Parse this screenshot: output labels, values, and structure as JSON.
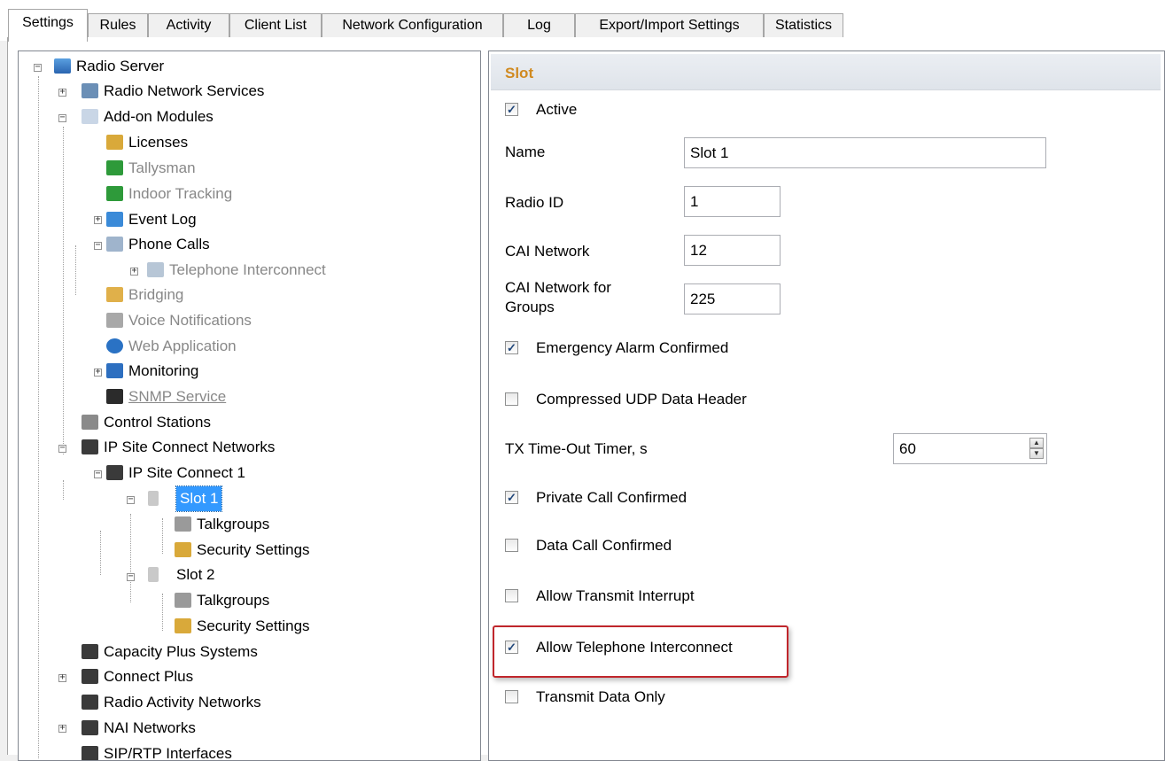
{
  "tabs": [
    "Settings",
    "Rules",
    "Activity",
    "Client List",
    "Network Configuration",
    "Log",
    "Export/Import Settings",
    "Statistics"
  ],
  "active_tab": "Settings",
  "tree": {
    "radio_server": "Radio Server",
    "radio_network_services": "Radio Network Services",
    "addon_modules": "Add-on Modules",
    "licenses": "Licenses",
    "tallysman": "Tallysman",
    "indoor_tracking": "Indoor Tracking",
    "event_log": "Event Log",
    "phone_calls": "Phone Calls",
    "telephone_interconnect": "Telephone Interconnect",
    "bridging": "Bridging",
    "voice_notifications": "Voice Notifications",
    "web_application": "Web Application",
    "monitoring": "Monitoring",
    "snmp_service": "SNMP Service",
    "control_stations": "Control Stations",
    "ip_site_connect_networks": "IP Site Connect Networks",
    "ip_site_connect_1": "IP Site Connect 1",
    "slot1": "Slot 1",
    "slot1_talkgroups": "Talkgroups",
    "slot1_security": "Security Settings",
    "slot2": "Slot 2",
    "slot2_talkgroups": "Talkgroups",
    "slot2_security": "Security Settings",
    "capacity_plus": "Capacity Plus Systems",
    "connect_plus": "Connect Plus",
    "radio_activity_networks": "Radio Activity Networks",
    "nai_networks": "NAI Networks",
    "sip_rtp": "SIP/RTP Interfaces"
  },
  "slot": {
    "title": "Slot",
    "active": {
      "label": "Active",
      "checked": true
    },
    "name": {
      "label": "Name",
      "value": "Slot 1"
    },
    "radio_id": {
      "label": "Radio ID",
      "value": "1"
    },
    "cai_network": {
      "label": "CAI Network",
      "value": "12"
    },
    "cai_groups": {
      "label_line1": "CAI Network for",
      "label_line2": "Groups",
      "value": "225"
    },
    "emergency_alarm": {
      "label": "Emergency Alarm Confirmed",
      "checked": true
    },
    "compressed_udp": {
      "label": "Compressed UDP Data Header",
      "checked": false
    },
    "tx_timeout": {
      "label": "TX Time-Out Timer, s",
      "value": "60"
    },
    "private_call": {
      "label": "Private Call Confirmed",
      "checked": true
    },
    "data_call": {
      "label": "Data Call Confirmed",
      "checked": false
    },
    "allow_transmit_interrupt": {
      "label": "Allow Transmit Interrupt",
      "checked": false
    },
    "allow_telephone_interconnect": {
      "label": "Allow Telephone Interconnect",
      "checked": true
    },
    "transmit_data_only": {
      "label": "Transmit Data Only",
      "checked": false
    }
  },
  "check_glyph": "✓",
  "colors": {
    "section_title": "#d08a20",
    "selection": "#3399ff",
    "highlight_border": "#c0262c"
  }
}
